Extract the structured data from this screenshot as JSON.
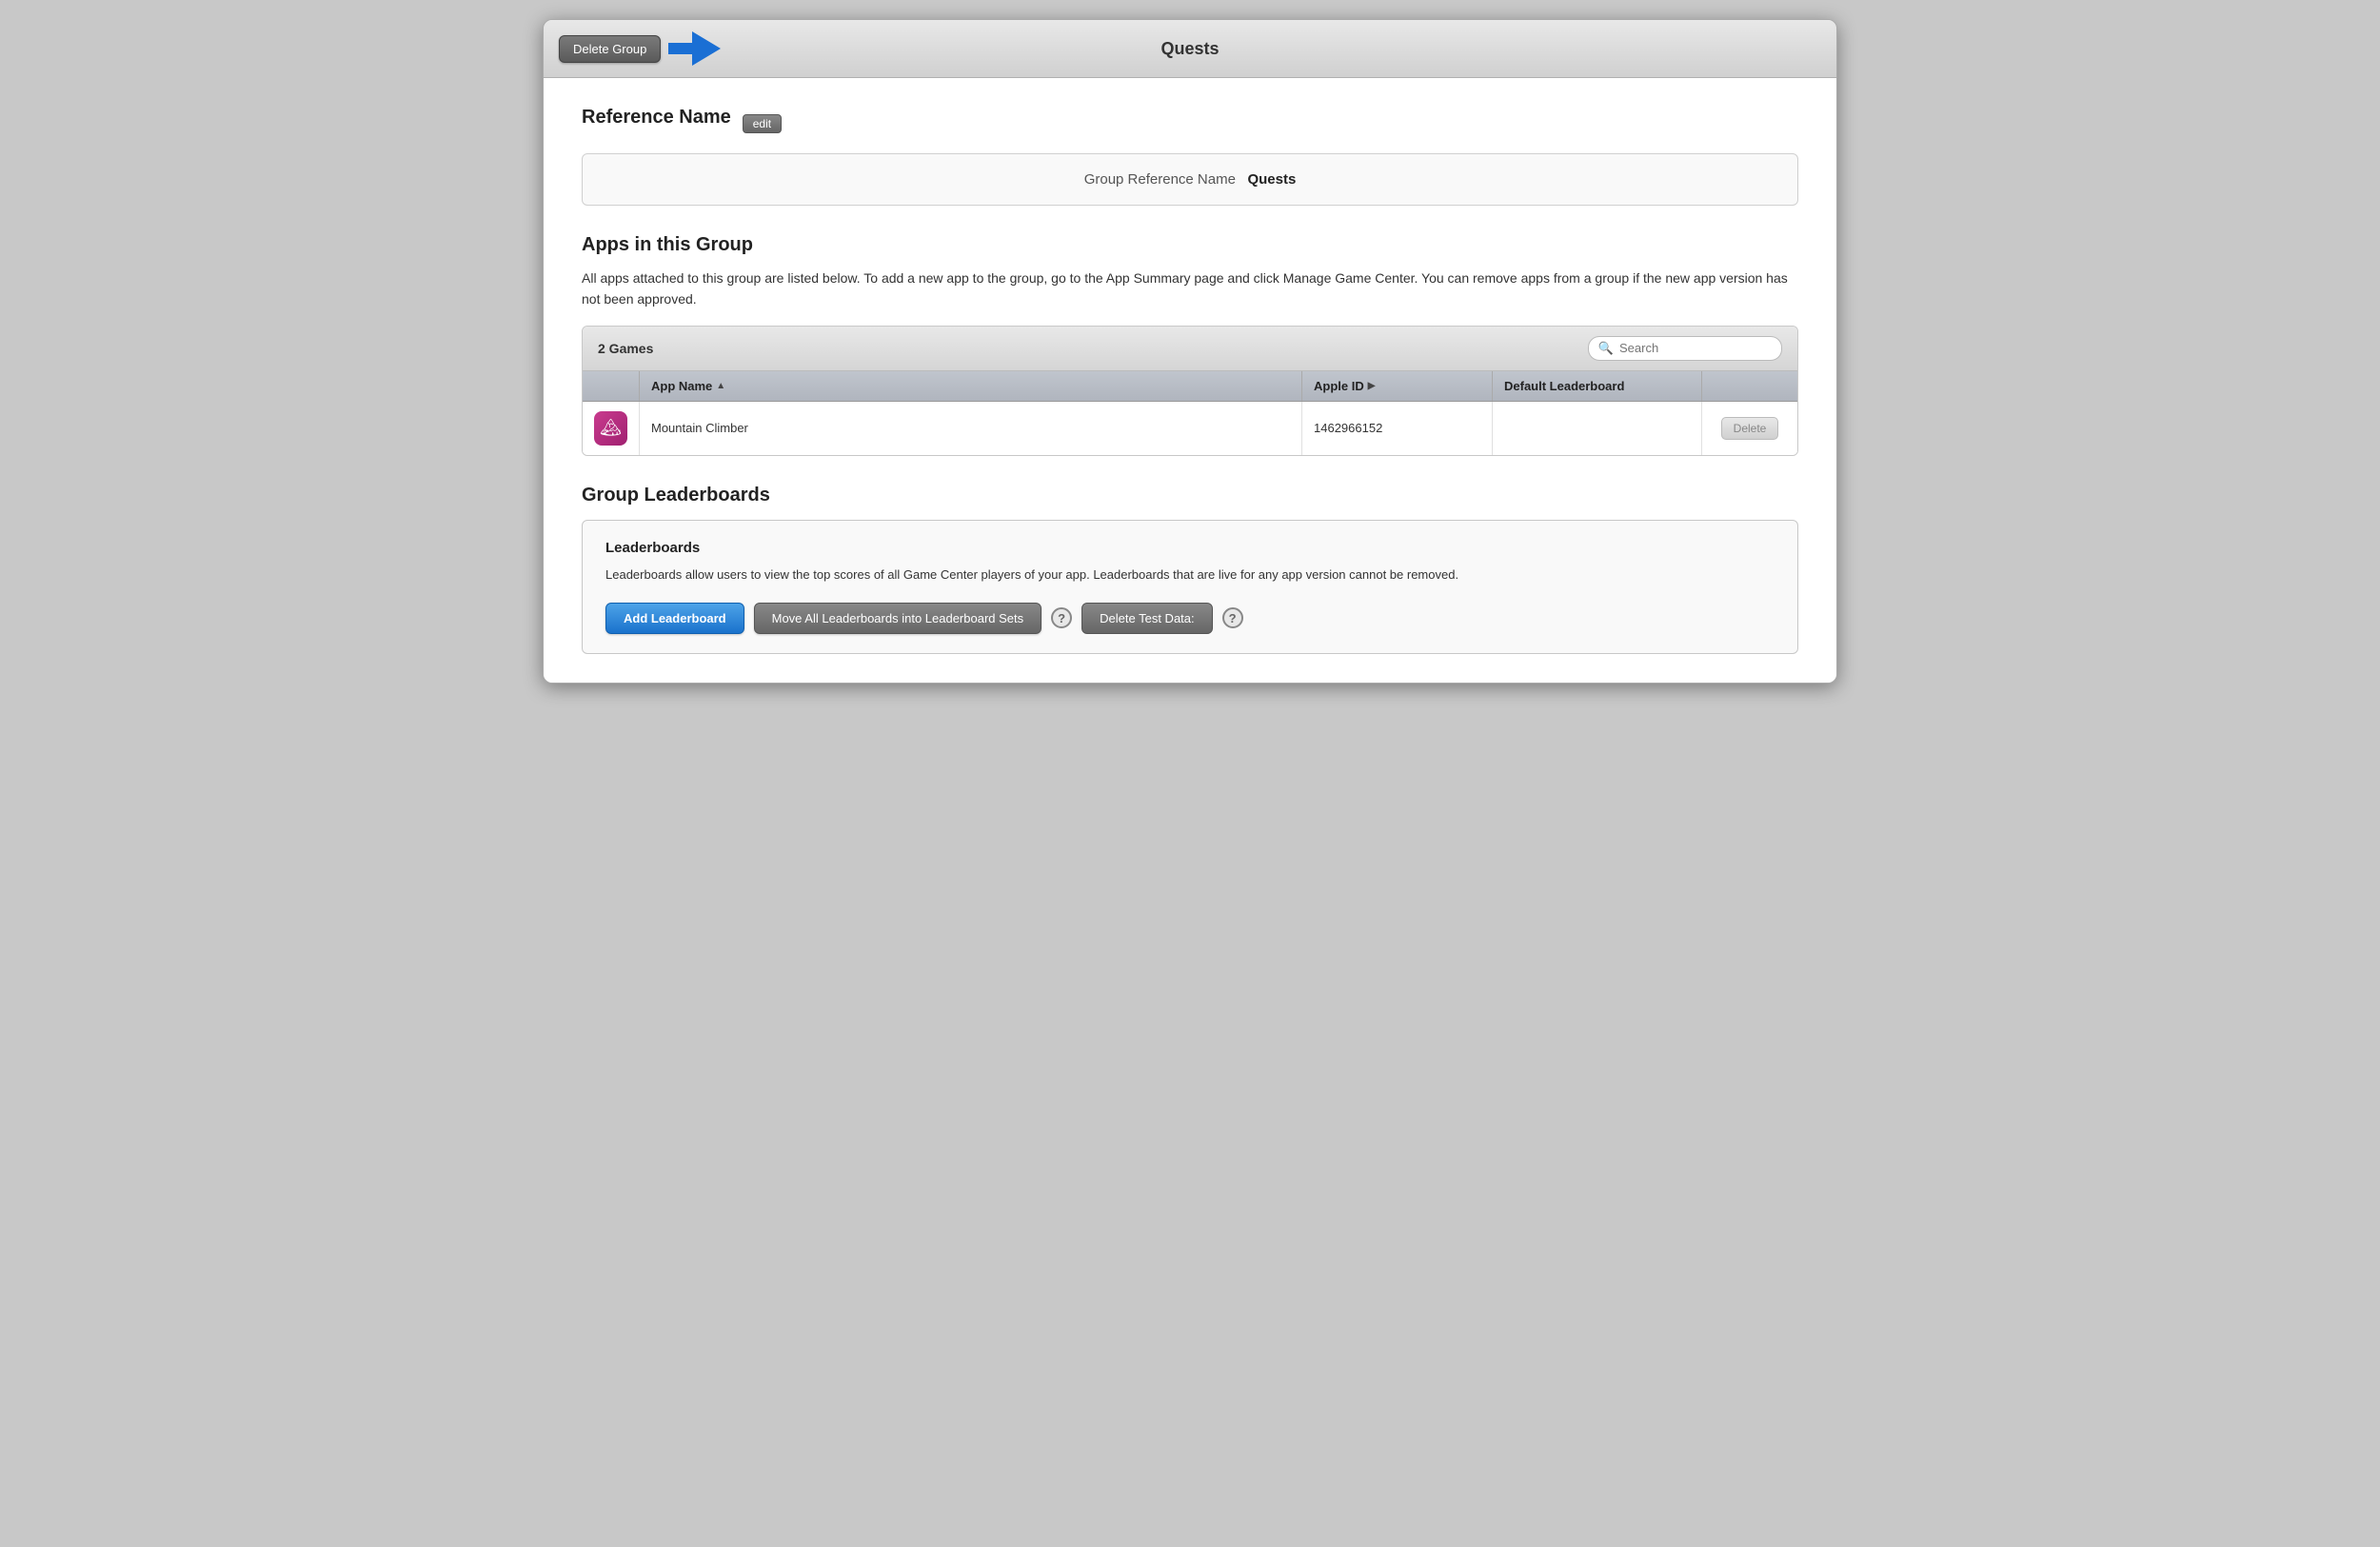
{
  "titleBar": {
    "title": "Quests",
    "deleteGroupLabel": "Delete Group"
  },
  "referenceName": {
    "sectionTitle": "Reference Name",
    "editLabel": "edit",
    "fieldLabel": "Group Reference Name",
    "fieldValue": "Quests"
  },
  "appsGroup": {
    "sectionTitle": "Apps in this Group",
    "description": "All apps attached to this group are listed below. To add a new app to the group, go to the App Summary page and click Manage Game Center. You can remove apps from a group if the new app version has not been approved.",
    "gamesCount": "2 Games",
    "search": {
      "placeholder": "Search"
    },
    "columns": {
      "appName": "App Name",
      "appleId": "Apple ID",
      "defaultLeaderboard": "Default Leaderboard",
      "action": ""
    },
    "rows": [
      {
        "iconEmoji": "🏔",
        "appName": "Mountain Climber",
        "appleId": "1462966152",
        "defaultLeaderboard": "",
        "deleteLabel": "Delete"
      }
    ]
  },
  "groupLeaderboards": {
    "sectionTitle": "Group Leaderboards",
    "subsectionTitle": "Leaderboards",
    "description": "Leaderboards allow users to view the top scores of all Game Center players of your app. Leaderboards that are live for any app version cannot be removed.",
    "addLeaderboardLabel": "Add Leaderboard",
    "moveLeaderboardsLabel": "Move All Leaderboards into Leaderboard Sets",
    "deleteTestDataLabel": "Delete Test Data:"
  }
}
